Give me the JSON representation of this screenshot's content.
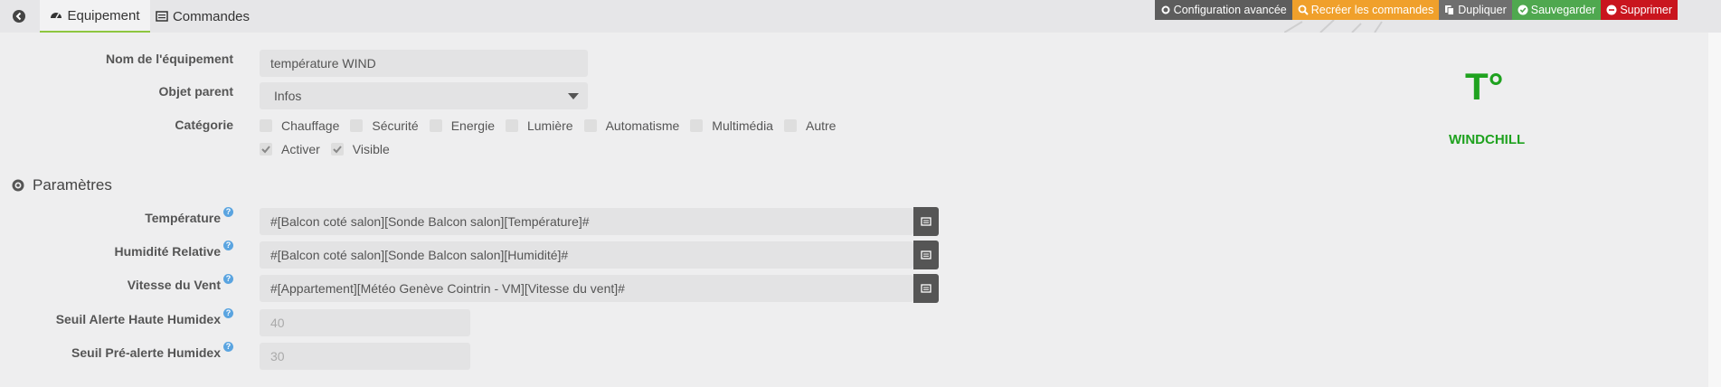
{
  "tabs": {
    "equipement": "Equipement",
    "commandes": "Commandes"
  },
  "actions": {
    "config": "Configuration avancée",
    "recreate": "Recréer les commandes",
    "duplicate": "Dupliquer",
    "save": "Sauvegarder",
    "delete": "Supprimer"
  },
  "form": {
    "name_label": "Nom de l'équipement",
    "name_value": "température WIND",
    "parent_label": "Objet parent",
    "parent_value": "Infos",
    "category_label": "Catégorie",
    "categories": [
      "Chauffage",
      "Sécurité",
      "Energie",
      "Lumière",
      "Automatisme",
      "Multimédia",
      "Autre"
    ],
    "activate": "Activer",
    "visible": "Visible"
  },
  "params": {
    "title": "Paramètres",
    "temp_label": "Température",
    "temp_value": "#[Balcon coté salon][Sonde Balcon salon][Température]#",
    "hum_label": "Humidité Relative",
    "hum_value": "#[Balcon coté salon][Sonde Balcon salon][Humidité]#",
    "wind_label": "Vitesse du Vent",
    "wind_value": "#[Appartement][Météo Genève Cointrin - VM][Vitesse du vent]#",
    "high_label": "Seuil Alerte Haute Humidex",
    "high_placeholder": "40",
    "pre_label": "Seuil Pré-alerte Humidex",
    "pre_placeholder": "30"
  },
  "device": {
    "icon_text": "T°",
    "name": "WINDCHILL",
    "color": "#1fa21f"
  }
}
